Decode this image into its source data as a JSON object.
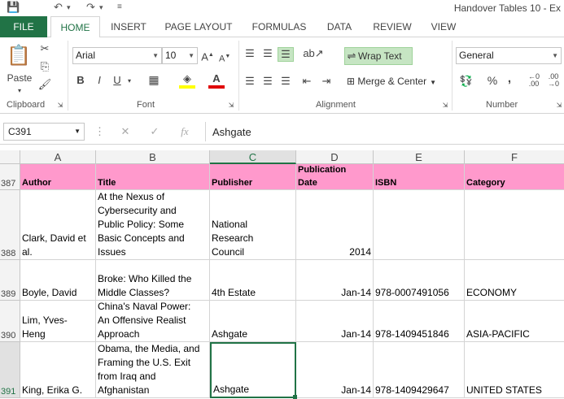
{
  "window": {
    "title": "Handover Tables 10 - Ex"
  },
  "tabs": [
    {
      "label": "FILE"
    },
    {
      "label": "HOME"
    },
    {
      "label": "INSERT"
    },
    {
      "label": "PAGE LAYOUT"
    },
    {
      "label": "FORMULAS"
    },
    {
      "label": "DATA"
    },
    {
      "label": "REVIEW"
    },
    {
      "label": "VIEW"
    }
  ],
  "ribbon": {
    "clipboard": {
      "label": "Clipboard",
      "paste": "Paste"
    },
    "font": {
      "label": "Font",
      "name": "Arial",
      "size": "10",
      "bold": "B",
      "italic": "I",
      "underline": "U"
    },
    "alignment": {
      "label": "Alignment",
      "wrap_text": "Wrap Text",
      "merge_center": "Merge & Center"
    },
    "number": {
      "label": "Number",
      "format": "General",
      "percent": "%",
      "comma": ","
    }
  },
  "formula_bar": {
    "name_box": "C391",
    "value": "Ashgate",
    "fx": "fx"
  },
  "columns": [
    "A",
    "B",
    "C",
    "D",
    "E",
    "F"
  ],
  "rows": [
    {
      "num": "387",
      "cells": [
        "Author",
        "Title",
        "Publisher",
        "Publication\nDate",
        "ISBN",
        "Category"
      ]
    },
    {
      "num": "388",
      "cells": [
        "Clark, David et\nal.",
        "At the Nexus of\nCybersecurity and\nPublic Policy: Some\nBasic Concepts and\nIssues",
        "National\nResearch\nCouncil",
        "2014",
        "",
        ""
      ]
    },
    {
      "num": "389",
      "cells": [
        "Boyle, David",
        "Broke: Who Killed the\nMiddle Classes?",
        "4th Estate",
        "Jan-14",
        "978-0007491056",
        "ECONOMY"
      ]
    },
    {
      "num": "390",
      "cells": [
        "Lim, Yves-\nHeng",
        "China's Naval Power:\nAn Offensive Realist\nApproach",
        "Ashgate",
        "Jan-14",
        "978-1409451846",
        "ASIA-PACIFIC"
      ]
    },
    {
      "num": "391",
      "cells": [
        "King, Erika G.",
        "Obama, the Media, and\nFraming the U.S. Exit\nfrom Iraq and\nAfghanistan",
        "Ashgate",
        "Jan-14",
        "978-1409429647",
        "UNITED STATES"
      ]
    }
  ],
  "colors": {
    "accent": "#217346",
    "header_fill": "#ff99cc",
    "wrap_active": "#c6e5c3"
  }
}
